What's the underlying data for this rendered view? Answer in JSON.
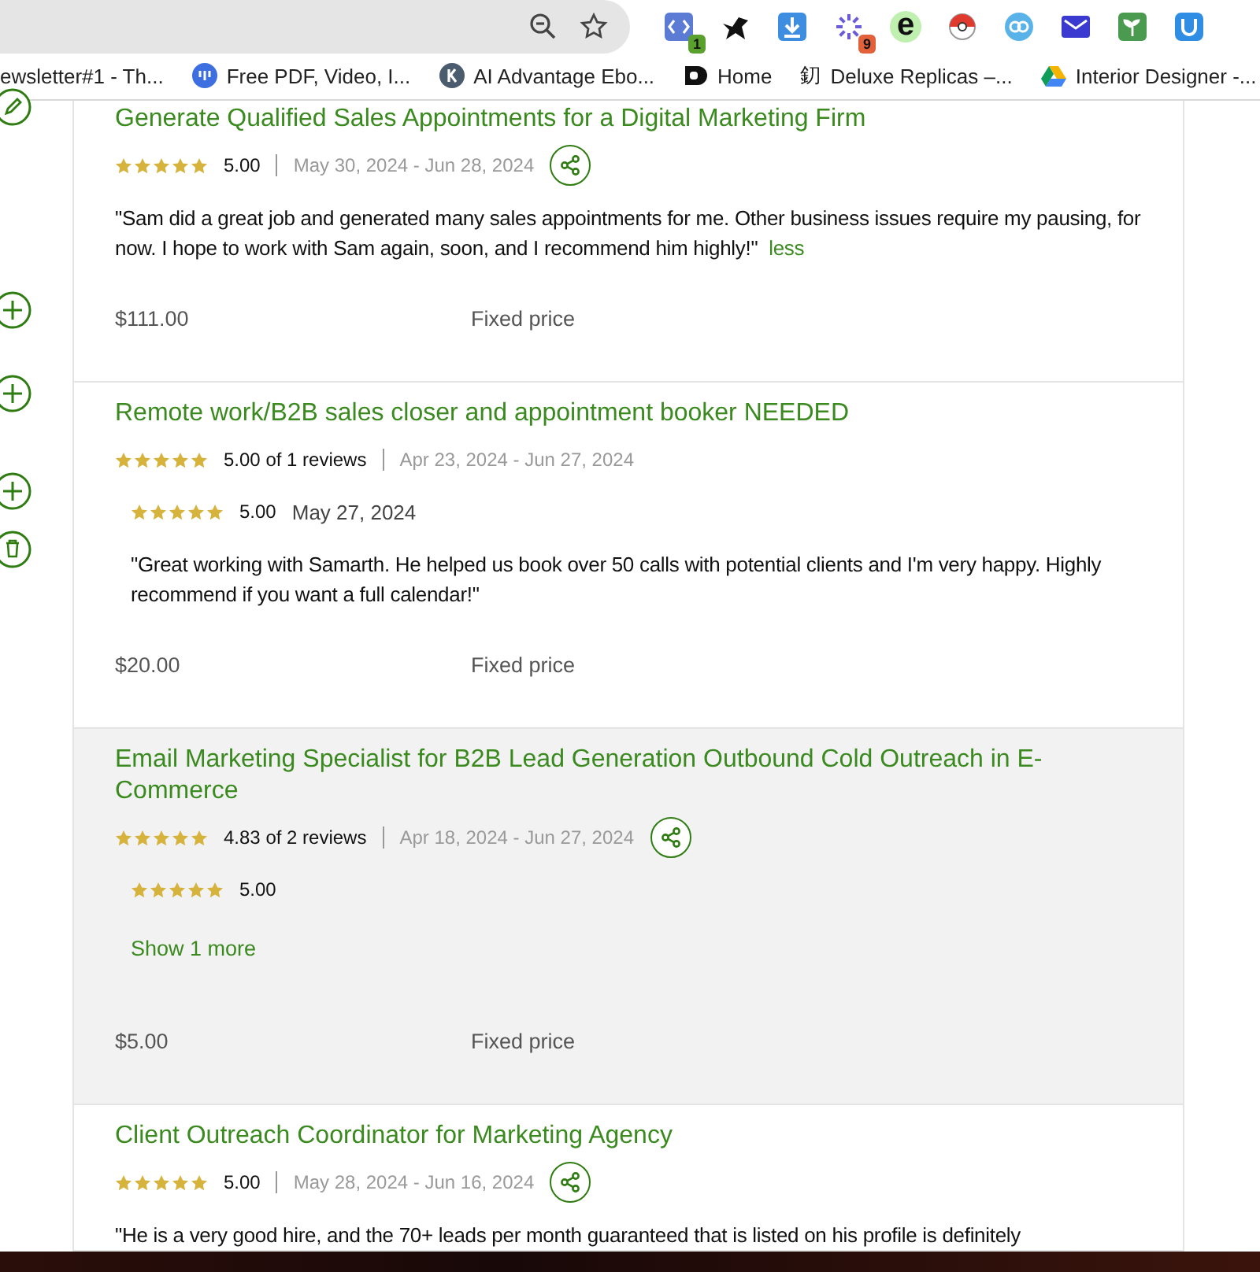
{
  "browser": {
    "extensions": [
      {
        "kind": "code",
        "badge": "1",
        "color": "#5aa02c"
      },
      {
        "kind": "bird"
      },
      {
        "kind": "download"
      },
      {
        "kind": "spinner",
        "badge": "9",
        "color": "#e2603a"
      },
      {
        "kind": "letter",
        "glyph": "e"
      },
      {
        "kind": "ball"
      },
      {
        "kind": "link"
      },
      {
        "kind": "mail"
      },
      {
        "kind": "plant"
      },
      {
        "kind": "u"
      }
    ],
    "bookmarks": [
      {
        "kind": "none",
        "label": "ewsletter#1 - Th..."
      },
      {
        "kind": "bars",
        "label": "Free PDF, Video, I..."
      },
      {
        "kind": "k",
        "label": "AI Advantage Ebo..."
      },
      {
        "kind": "d",
        "label": "Home"
      },
      {
        "kind": "glyph",
        "glyph": "釖",
        "label": "Deluxe Replicas –..."
      },
      {
        "kind": "drive",
        "label": "Interior Designer -..."
      }
    ]
  },
  "sidebar_icons": [
    {
      "kind": "edit"
    },
    {
      "kind": "add"
    },
    {
      "kind": "add"
    },
    {
      "kind": "add"
    },
    {
      "kind": "delete"
    }
  ],
  "jobs": [
    {
      "title": "Generate Qualified Sales Appointments for a Digital Marketing Firm",
      "highlighted": false,
      "stars": 5,
      "rating": "5.00",
      "dates": "May 30, 2024 - Jun 28, 2024",
      "share": true,
      "quote": "\"Sam did a great job and generated many sales appointments for me. Other business issues require my pausing, for now. I hope to work with Sam again, soon, and I recommend him highly!\"",
      "quote_link": "less",
      "price": "$111.00",
      "price_type": "Fixed price"
    },
    {
      "title": "Remote work/B2B sales closer and appointment booker NEEDED",
      "highlighted": false,
      "stars": 5,
      "rating": "5.00 of 1 reviews",
      "dates": "Apr 23, 2024 - Jun 27, 2024",
      "share": false,
      "reviews": [
        {
          "stars": 5,
          "rating": "5.00",
          "date": "May 27, 2024",
          "quote": "\"Great working with Samarth. He helped us book over 50 calls with potential clients and I'm very happy. Highly recommend if you want a full calendar!\""
        }
      ],
      "price": "$20.00",
      "price_type": "Fixed price"
    },
    {
      "title": "Email Marketing Specialist for B2B Lead Generation Outbound Cold Outreach in E-Commerce",
      "highlighted": true,
      "stars": 5,
      "rating": "4.83 of 2 reviews",
      "dates": "Apr 18, 2024 - Jun 27, 2024",
      "share": true,
      "reviews": [
        {
          "stars": 5,
          "rating": "5.00"
        }
      ],
      "show_more": "Show 1 more",
      "price": "$5.00",
      "price_type": "Fixed price"
    },
    {
      "title": "Client Outreach Coordinator for Marketing Agency",
      "highlighted": false,
      "stars": 5,
      "rating": "5.00",
      "dates": "May 28, 2024 - Jun 16, 2024",
      "share": true,
      "quote": "\"He is a very good hire, and the 70+ leads per month guaranteed that is listed on his profile is definitely"
    }
  ]
}
